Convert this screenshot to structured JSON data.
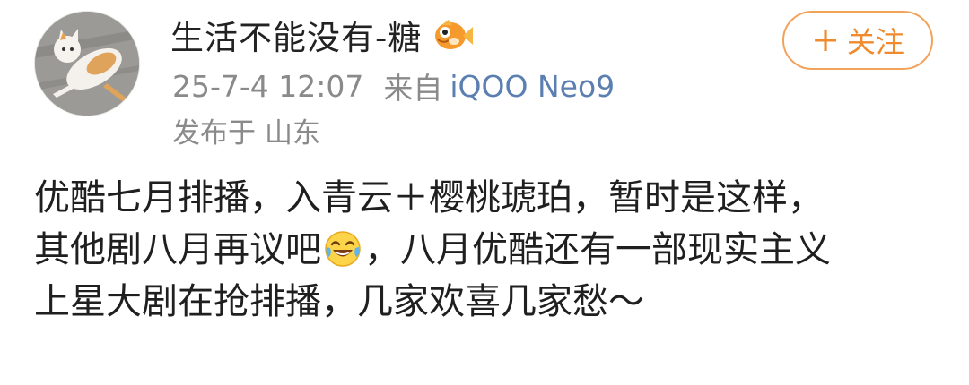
{
  "user": {
    "name": "生活不能没有-糖",
    "avatar_icon": "cat-avatar",
    "badge_icon": "fish-icon"
  },
  "meta": {
    "time": "25-7-4 12:07",
    "from_label": "来自",
    "device": "iQOO Neo9"
  },
  "location": {
    "label": "发布于",
    "place": "山东"
  },
  "follow_button": {
    "plus": "+",
    "label": "关注"
  },
  "post": {
    "line1": "优酷七月排播，入青云＋樱桃琥珀，暂时是这样，",
    "line2_before_emoji": "其他剧八月再议吧",
    "emoji_icon": "laughing-tears-emoji",
    "line2_after_emoji": "，八月优酷还有一部现实主义",
    "line3": "上星大剧在抢排播，几家欢喜几家愁～"
  },
  "colors": {
    "follow_orange": "#ef8a2e",
    "meta_gray": "#8a8a8a",
    "device_blue": "#5b7fb0"
  }
}
